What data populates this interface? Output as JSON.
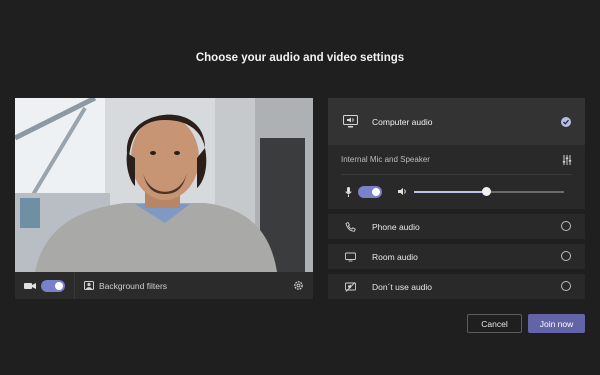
{
  "title": "Choose your audio and video settings",
  "video": {
    "camera_on": true,
    "background_filters_label": "Background filters"
  },
  "audio": {
    "computer_audio_label": "Computer audio",
    "computer_audio_selected": true,
    "device_label": "Internal Mic and Speaker",
    "mic_on": true,
    "volume_level": 0.48,
    "options": [
      {
        "label": "Phone audio",
        "icon": "phone-icon"
      },
      {
        "label": "Room audio",
        "icon": "monitor-icon"
      },
      {
        "label": "Don´t use audio",
        "icon": "speaker-off-icon"
      }
    ]
  },
  "buttons": {
    "cancel": "Cancel",
    "join": "Join now"
  },
  "colors": {
    "accent": "#6264a7",
    "toggle": "#7a80c9",
    "background": "#1f1f1f"
  }
}
